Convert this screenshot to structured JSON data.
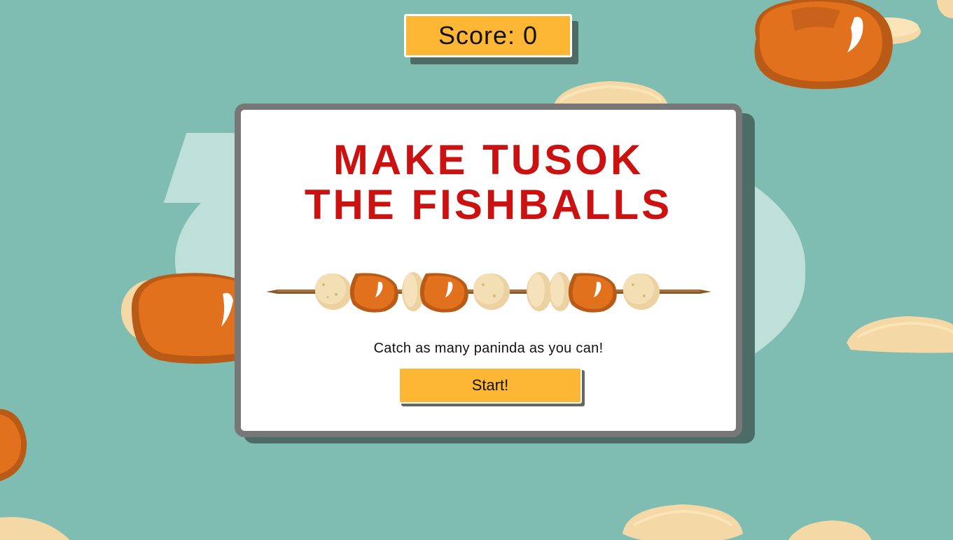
{
  "hud": {
    "score_label": "Score: 0",
    "score_value": 0
  },
  "start_screen": {
    "title_line1": "MAKE TUSOK",
    "title_line2": "THE FISHBALLS",
    "instructions": "Catch as many paninda as you can!",
    "start_label": "Start!"
  },
  "colors": {
    "background": "#7fbcb1",
    "accent": "#fdb734",
    "title": "#cc1111",
    "kwekkwek": "#e2711d",
    "fishball": "#f4d9a6"
  },
  "icons": {
    "skewer": "fishball-skewer-icon",
    "kwekkwek": "kwek-kwek-icon",
    "fishball": "fishball-icon",
    "squidball": "squidball-icon"
  }
}
